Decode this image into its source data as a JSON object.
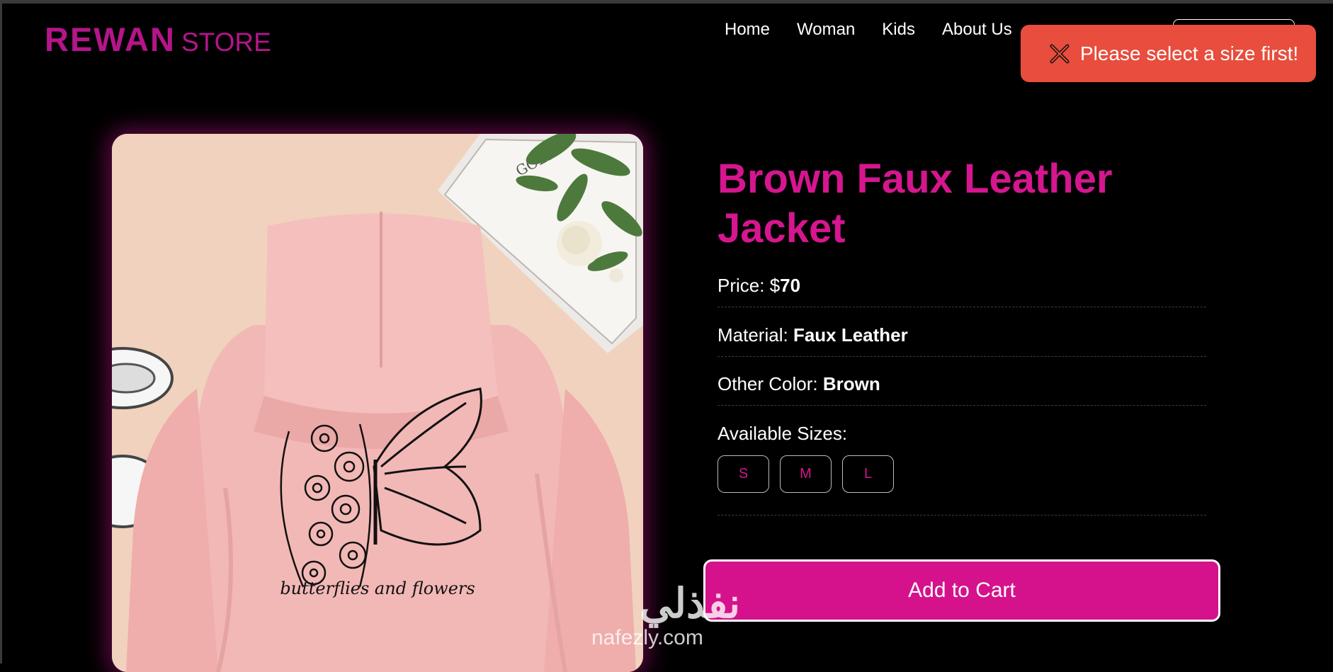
{
  "header": {
    "logo_main": "REWAN",
    "logo_sub": "STORE",
    "nav": [
      "Home",
      "Woman",
      "Kids",
      "About Us"
    ]
  },
  "toast": {
    "message": "Please select a size first!",
    "icon": "close-icon",
    "color": "#e84d3d"
  },
  "product": {
    "title": "Brown Faux Leather Jacket",
    "price_label": "Price:",
    "price_value": "$",
    "price_amount": "70",
    "material_label": "Material:",
    "material_value": "Faux Leather",
    "color_label": "Other Color:",
    "color_value": "Brown",
    "sizes_label": "Available Sizes:",
    "sizes": [
      "S",
      "M",
      "L"
    ],
    "add_to_cart": "Add to Cart",
    "image_text": "butterflies and flowers"
  },
  "watermark": {
    "arabic": "نفذلي",
    "domain": "nafezly.com"
  },
  "colors": {
    "accent": "#d5168f",
    "logo": "#b5158a",
    "background": "#000000",
    "button": "#d5128c"
  }
}
